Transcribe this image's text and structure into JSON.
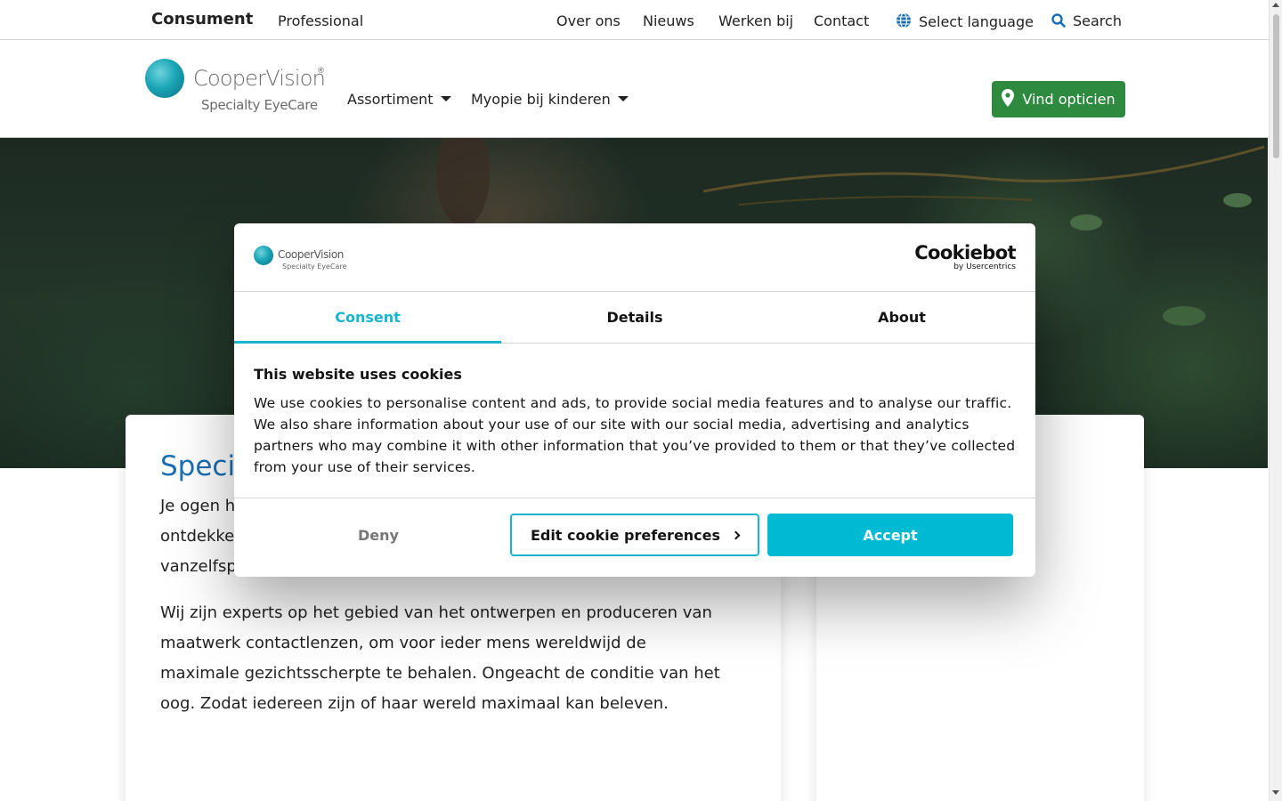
{
  "topbar": {
    "audience_active": "Consument",
    "audience_other": "Professional",
    "links": [
      "Over ons",
      "Nieuws",
      "Werken bij",
      "Contact"
    ],
    "language_label": "Select language",
    "search_label": "Search"
  },
  "header": {
    "logo_name": "CooperVision",
    "logo_mark": "®",
    "logo_sub": "Specialty EyeCare",
    "nav": [
      "Assortiment",
      "Myopie bij kinderen"
    ],
    "find_button": "Vind opticien"
  },
  "content": {
    "heading": "Specia",
    "para1_lines": [
      "Je ogen h",
      "ontdekken",
      "vanzelfsp"
    ],
    "para2": "Wij zijn experts op het gebied van het ontwerpen en produceren van maatwerk contactlenzen, om voor ieder mens wereldwijd de maximale gezichtsscherpte te behalen. Ongeacht de conditie van het oog. Zodat iedereen zijn of haar wereld maximaal kan beleven."
  },
  "cookie_dialog": {
    "logo_name": "CooperVision",
    "logo_sub": "Specialty EyeCare",
    "brand": "Cookiebot",
    "brand_sub": "by Usercentrics",
    "tabs": [
      "Consent",
      "Details",
      "About"
    ],
    "active_tab": "Consent",
    "title": "This website uses cookies",
    "body": "We use cookies to personalise content and ads, to provide social media features and to analyse our traffic. We also share information about your use of our site with our social media, advertising and analytics partners who may combine it with other information that you’ve provided to them or that they’ve collected from your use of their services.",
    "deny": "Deny",
    "edit": "Edit cookie preferences",
    "accept": "Accept"
  },
  "colors": {
    "accent": "#17b6cc",
    "accept_bg": "#00bad4",
    "find_button_bg": "#2e8a3f",
    "heading_blue": "#1a6fb3"
  },
  "icons": {
    "language": "globe-icon",
    "search": "search-icon",
    "find": "map-pin-icon",
    "dropdown": "caret-down-icon",
    "edit": "chevron-right-icon"
  }
}
